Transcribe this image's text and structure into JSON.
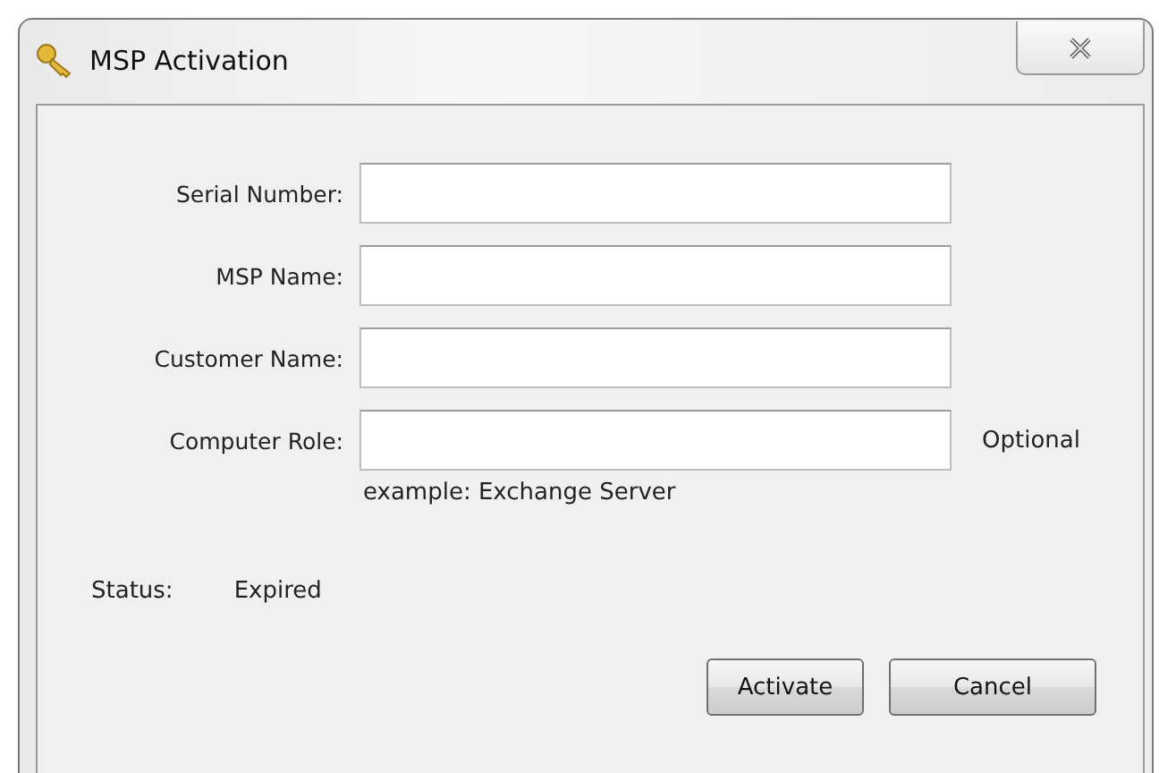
{
  "window": {
    "title": "MSP Activation"
  },
  "fields": [
    {
      "label": "Serial Number:"
    },
    {
      "label": "MSP Name:"
    },
    {
      "label": "Customer Name:"
    },
    {
      "label": "Computer Role:",
      "note": "Optional",
      "hint": "example: Exchange Server"
    }
  ],
  "status": {
    "label": "Status:",
    "value": "Expired"
  },
  "buttons": [
    "Activate",
    "Cancel"
  ]
}
